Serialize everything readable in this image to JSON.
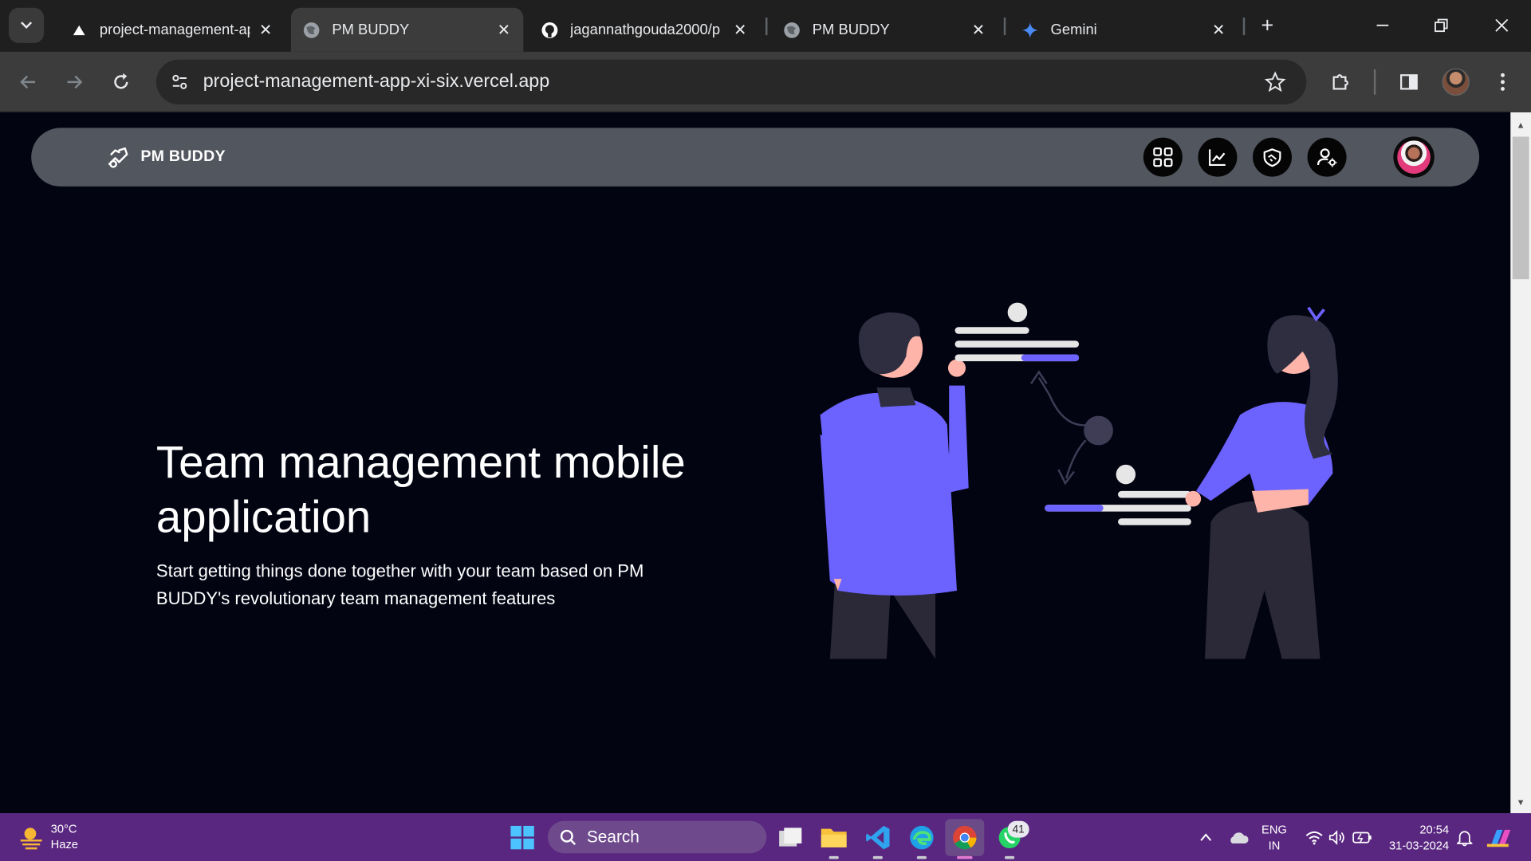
{
  "browser": {
    "tabs": [
      {
        "title": "project-management-app",
        "favicon": "vercel-triangle-icon",
        "active": false
      },
      {
        "title": "PM BUDDY",
        "favicon": "globe-icon",
        "active": true
      },
      {
        "title": "jagannathgouda2000/p",
        "favicon": "github-icon",
        "active": false
      },
      {
        "title": "PM BUDDY",
        "favicon": "globe-icon",
        "active": false
      },
      {
        "title": "Gemini",
        "favicon": "gemini-sparkle-icon",
        "active": false
      }
    ],
    "address": "project-management-app-xi-six.vercel.app"
  },
  "navbar": {
    "brand": "PM BUDDY",
    "icons": [
      "dashboard-grid-icon",
      "analytics-chart-icon",
      "handshake-icon",
      "user-settings-icon"
    ]
  },
  "hero": {
    "title": "Team management mobile application",
    "subtitle": "Start getting things done together with your team based on PM BUDDY's revolutionary team management features"
  },
  "taskbar": {
    "weather_temp": "30°C",
    "weather_condition": "Haze",
    "search_label": "Search",
    "whatsapp_badge": "41",
    "language_primary": "ENG",
    "language_secondary": "IN",
    "time": "20:54",
    "date": "31-03-2024"
  },
  "colors": {
    "accent": "#6c63ff",
    "page_bg": "#020412",
    "navbar_bg": "#52565f",
    "taskbar_bg": "#5a2780"
  }
}
